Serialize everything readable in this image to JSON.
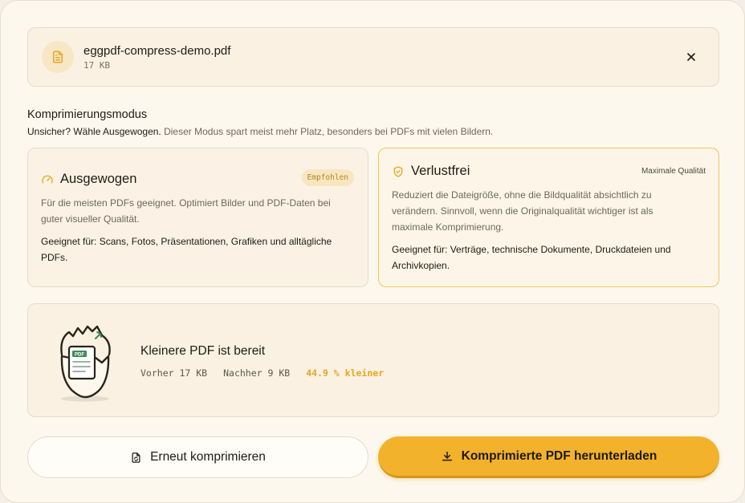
{
  "file": {
    "name": "eggpdf-compress-demo.pdf",
    "size": "17 KB",
    "icon": "document-icon",
    "close_icon": "close-icon"
  },
  "mode_section": {
    "title": "Komprimierungsmodus",
    "hint_strong": "Unsicher? Wähle Ausgewogen.",
    "hint_rest": " Dieser Modus spart meist mehr Platz, besonders bei PDFs mit vielen Bildern."
  },
  "modes": [
    {
      "title": "Ausgewogen",
      "icon": "gauge-icon",
      "badge": "Empfohlen",
      "description": "Für die meisten PDFs geeignet. Optimiert Bilder und PDF-Daten bei guter visueller Qualität.",
      "fit": "Geeignet für: Scans, Fotos, Präsentationen, Grafiken und alltägliche PDFs.",
      "selected": false
    },
    {
      "title": "Verlustfrei",
      "icon": "shield-check-icon",
      "badge": "Maximale Qualität",
      "description": "Reduziert die Dateigröße, ohne die Bildqualität absichtlich zu verändern. Sinnvoll, wenn die Originalqualität wichtiger ist als maximale Komprimierung.",
      "fit": "Geeignet für: Verträge, technische Dokumente, Druckdateien und Archivkopien.",
      "selected": true
    }
  ],
  "result": {
    "title": "Kleinere PDF ist bereit",
    "before": "Vorher 17 KB",
    "after": "Nachher 9 KB",
    "reduction": "44.9 % kleiner",
    "illustration_label": "PDF"
  },
  "actions": {
    "recompress": "Erneut komprimieren",
    "download": "Komprimierte PDF herunterladen"
  },
  "colors": {
    "accent": "#f2b22b",
    "accent_text": "#e8a620",
    "background": "#fdf8ee"
  }
}
